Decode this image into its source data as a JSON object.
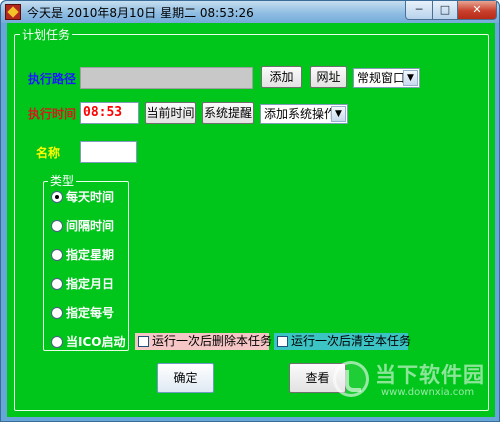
{
  "window": {
    "title": "今天是 2010年8月10日 星期二 08:53:26",
    "min_glyph": "─",
    "max_glyph": "□",
    "close_glyph": "✕"
  },
  "group": {
    "caption": "计划任务"
  },
  "path_row": {
    "label": "执行路径",
    "label_color": "#1a1aff",
    "value": "",
    "add_button": "添加",
    "url_button": "网址",
    "window_mode": "常规窗口"
  },
  "time_row": {
    "label": "执行时间",
    "label_color": "#d41a1a",
    "time_value": "08:53",
    "current_time_button": "当前时间",
    "system_reminder_button": "系统提醒",
    "system_action": "添加系统操作"
  },
  "name_row": {
    "label": "名称",
    "label_color": "#ffff00",
    "value": ""
  },
  "type_group": {
    "caption": "类型",
    "options": [
      {
        "label": "每天时间",
        "checked": true
      },
      {
        "label": "间隔时间",
        "checked": false
      },
      {
        "label": "指定星期",
        "checked": false
      },
      {
        "label": "指定月日",
        "checked": false
      },
      {
        "label": "指定每号",
        "checked": false
      },
      {
        "label": "当ICO启动",
        "checked": false
      }
    ]
  },
  "checkboxes": {
    "delete_after_run": "运行一次后删除本任务",
    "delete_color": "#f6c6c6",
    "clear_after_run": "运行一次后清空本任务",
    "clear_color": "#3cc3c3"
  },
  "footer": {
    "confirm_button": "确定",
    "view_button": "查看"
  },
  "watermark": {
    "brand": "当下软件园",
    "site": "www.downxia.com"
  }
}
